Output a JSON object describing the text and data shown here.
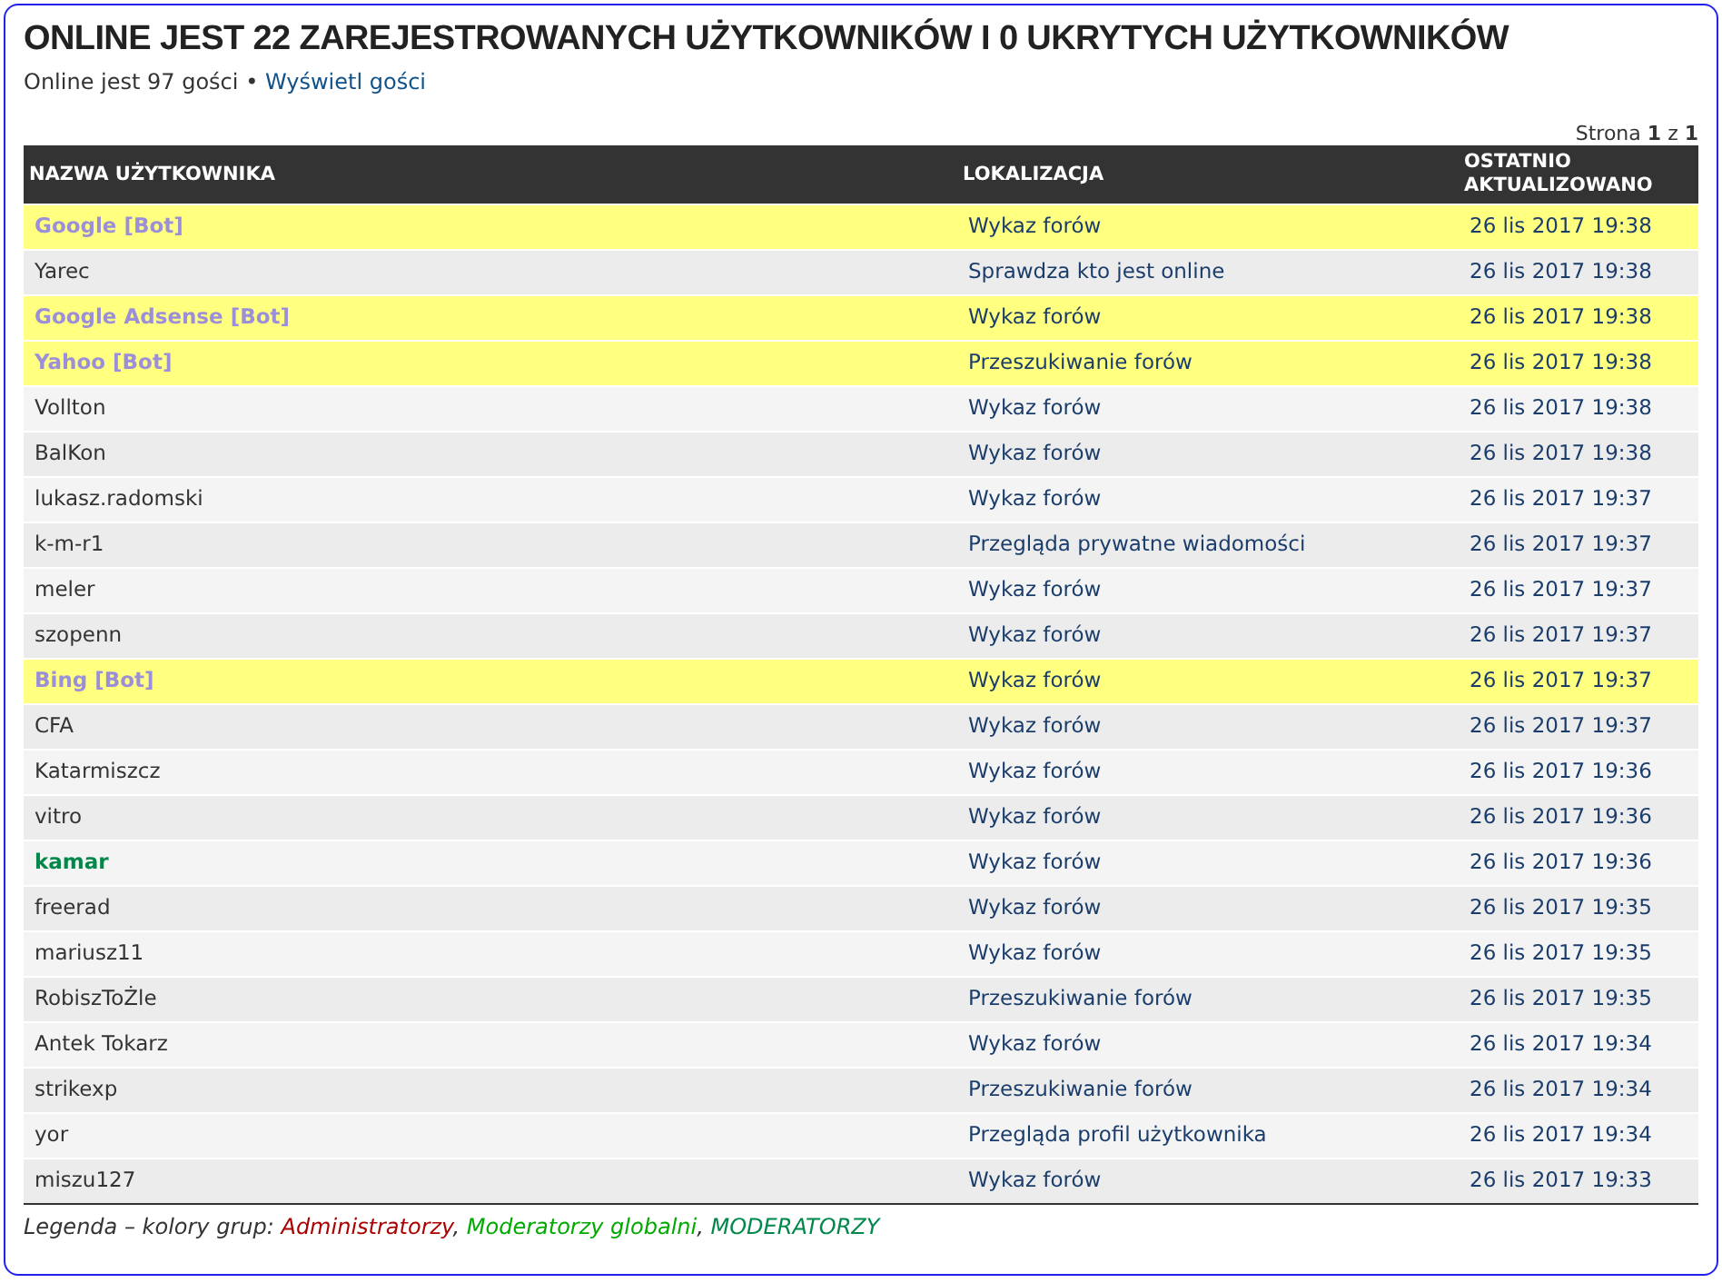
{
  "title": "ONLINE JEST 22 ZAREJESTROWANYCH UŻYTKOWNIKÓW I 0 UKRYTYCH UŻYTKOWNIKÓW",
  "guests_summary": "Online jest 97 gości",
  "separator": "•",
  "guests_link": "Wyświetl gości",
  "pagination": {
    "label": "Strona",
    "current": "1",
    "of": "z",
    "total": "1"
  },
  "table": {
    "columns": [
      "NAZWA UŻYTKOWNIKA",
      "LOKALIZACJA",
      "OSTATNIO AKTUALIZOWANO"
    ],
    "rows": [
      {
        "kind": "bot",
        "user": "Google [Bot]",
        "location": "Wykaz forów",
        "time": "26 lis 2017 19:38"
      },
      {
        "kind": "user",
        "user": "Yarec",
        "location": "Sprawdza kto jest online",
        "time": "26 lis 2017 19:38"
      },
      {
        "kind": "bot",
        "user": "Google Adsense [Bot]",
        "location": "Wykaz forów",
        "time": "26 lis 2017 19:38"
      },
      {
        "kind": "bot",
        "user": "Yahoo [Bot]",
        "location": "Przeszukiwanie forów",
        "time": "26 lis 2017 19:38"
      },
      {
        "kind": "user",
        "user": "Vollton",
        "location": "Wykaz forów",
        "time": "26 lis 2017 19:38"
      },
      {
        "kind": "user",
        "user": "BalKon",
        "location": "Wykaz forów",
        "time": "26 lis 2017 19:38"
      },
      {
        "kind": "user",
        "user": "lukasz.radomski",
        "location": "Wykaz forów",
        "time": "26 lis 2017 19:37"
      },
      {
        "kind": "user",
        "user": "k-m-r1",
        "location": "Przegląda prywatne wiadomości",
        "time": "26 lis 2017 19:37"
      },
      {
        "kind": "user",
        "user": "meler",
        "location": "Wykaz forów",
        "time": "26 lis 2017 19:37"
      },
      {
        "kind": "user",
        "user": "szopenn",
        "location": "Wykaz forów",
        "time": "26 lis 2017 19:37"
      },
      {
        "kind": "bot",
        "user": "Bing [Bot]",
        "location": "Wykaz forów",
        "time": "26 lis 2017 19:37"
      },
      {
        "kind": "user",
        "user": "CFA",
        "location": "Wykaz forów",
        "time": "26 lis 2017 19:37"
      },
      {
        "kind": "user",
        "user": "Katarmiszcz",
        "location": "Wykaz forów",
        "time": "26 lis 2017 19:36"
      },
      {
        "kind": "user",
        "user": "vitro",
        "location": "Wykaz forów",
        "time": "26 lis 2017 19:36"
      },
      {
        "kind": "group",
        "color": "#00884a",
        "user": "kamar",
        "location": "Wykaz forów",
        "time": "26 lis 2017 19:36"
      },
      {
        "kind": "user",
        "user": "freerad",
        "location": "Wykaz forów",
        "time": "26 lis 2017 19:35"
      },
      {
        "kind": "user",
        "user": "mariusz11",
        "location": "Wykaz forów",
        "time": "26 lis 2017 19:35"
      },
      {
        "kind": "user",
        "user": "RobiszToŻle",
        "location": "Przeszukiwanie forów",
        "time": "26 lis 2017 19:35"
      },
      {
        "kind": "user",
        "user": "Antek Tokarz",
        "location": "Wykaz forów",
        "time": "26 lis 2017 19:34"
      },
      {
        "kind": "user",
        "user": "strikexp",
        "location": "Przeszukiwanie forów",
        "time": "26 lis 2017 19:34"
      },
      {
        "kind": "user",
        "user": "yor",
        "location": "Przegląda profil użytkownika",
        "time": "26 lis 2017 19:34"
      },
      {
        "kind": "user",
        "user": "miszu127",
        "location": "Wykaz forów",
        "time": "26 lis 2017 19:33"
      }
    ]
  },
  "legend": {
    "label": "Legenda – kolory grup:",
    "delimiter": ",",
    "groups": [
      {
        "name": "Administratorzy",
        "color": "#aa0000"
      },
      {
        "name": "Moderatorzy globalni",
        "color": "#00aa00"
      },
      {
        "name": "MODERATORZY",
        "color": "#00884a"
      }
    ]
  }
}
